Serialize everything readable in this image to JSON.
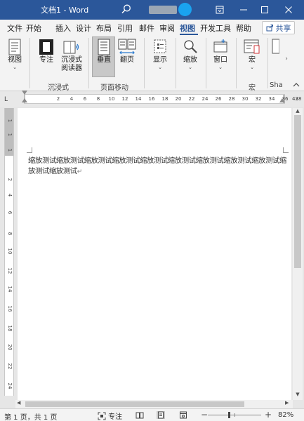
{
  "window": {
    "title": "文档1 - Word",
    "controls": {
      "minimize": "—",
      "maximize": "□",
      "close": "✕"
    }
  },
  "ribbon_tabs": [
    "文件",
    "开始",
    "插入",
    "设计",
    "布局",
    "引用",
    "邮件",
    "审阅",
    "视图",
    "开发工具",
    "帮助"
  ],
  "active_tab": "视图",
  "share": {
    "label": "共享"
  },
  "ribbon": {
    "views": {
      "label": "视图"
    },
    "immersive": {
      "focus": "专注",
      "reader": [
        "沉浸式",
        "阅读器"
      ],
      "group_label": "沉浸式"
    },
    "page_movement": {
      "vertical": "垂直",
      "side_to_side": "翻页",
      "group_label": "页面移动"
    },
    "show": {
      "label": "显示"
    },
    "zoom": {
      "label": "缩放"
    },
    "window": {
      "label": "窗口"
    },
    "macros": {
      "label": "宏",
      "group_label": "宏"
    },
    "sharepoint": {
      "group_label": "Sha"
    }
  },
  "ruler": {
    "ticks": [
      "2",
      "4",
      "6",
      "8",
      "10",
      "12",
      "14",
      "16",
      "18",
      "20",
      "22",
      "24",
      "26",
      "28",
      "30",
      "32",
      "34",
      "36",
      "38"
    ],
    "end": "42",
    "vertical_ticks": [
      "1",
      "1",
      "1",
      "2",
      "4",
      "6",
      "8",
      "10",
      "12",
      "14",
      "16",
      "18",
      "20",
      "22",
      "24"
    ]
  },
  "document": {
    "text": "缩放测试缩放测试缩放测试缩放测试缩放测试缩放测试缩放测试缩放测试缩放测试缩放测试缩放测试",
    "paragraph_mark": "↵"
  },
  "status": {
    "pages": "第 1 页，共 1 页",
    "focus": "专注",
    "zoom_minus": "−",
    "zoom_plus": "+",
    "zoom": "82%",
    "zoom_value": 82
  }
}
